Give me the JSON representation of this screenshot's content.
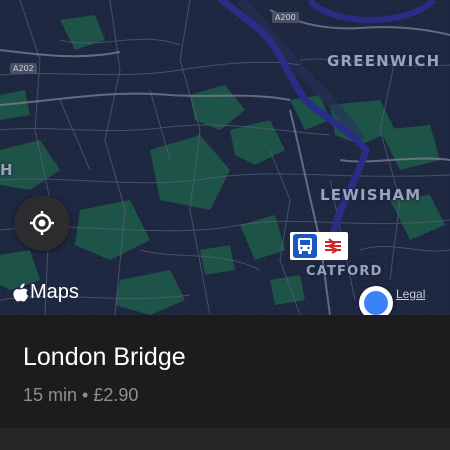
{
  "map": {
    "places": {
      "greenwich": "GREENWICH",
      "lewisham": "LEWISHAM",
      "catford": "CATFORD",
      "edge_h": "H"
    },
    "roads": {
      "a200": "A200",
      "a202": "A202"
    },
    "attribution": {
      "brand": "Maps",
      "legal": "Legal"
    },
    "icons": {
      "locate": "location-crosshair-icon",
      "apple": "apple-logo-icon",
      "bus": "bus-icon",
      "rail": "national-rail-icon"
    },
    "colors": {
      "route": "#2a2d86",
      "user_location": "#3b82f6",
      "map_background": "#1e2740",
      "park_green": "#1f5b4a"
    }
  },
  "destination": {
    "name": "London Bridge",
    "details": "15 min • £2.90"
  }
}
